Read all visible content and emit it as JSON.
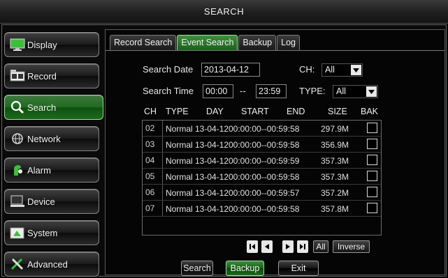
{
  "window": {
    "title": "SEARCH"
  },
  "sidebar": {
    "items": [
      {
        "label": "Display",
        "icon": "monitor-icon"
      },
      {
        "label": "Record",
        "icon": "film-icon"
      },
      {
        "label": "Search",
        "icon": "search-icon",
        "active": true
      },
      {
        "label": "Network",
        "icon": "globe-icon"
      },
      {
        "label": "Alarm",
        "icon": "alarm-icon"
      },
      {
        "label": "Device",
        "icon": "device-icon"
      },
      {
        "label": "System",
        "icon": "system-icon"
      },
      {
        "label": "Advanced",
        "icon": "tools-icon"
      }
    ]
  },
  "tabs": [
    {
      "label": "Record Search"
    },
    {
      "label": "Event Search",
      "active": true
    },
    {
      "label": "Backup"
    },
    {
      "label": "Log"
    }
  ],
  "form": {
    "search_date_label": "Search Date",
    "search_date_value": "2013-04-12",
    "ch_label": "CH:",
    "ch_value": "All",
    "search_time_label": "Search Time",
    "time_from": "00:00",
    "time_sep": "--",
    "time_to": "23:59",
    "type_label": "TYPE:",
    "type_value": "All"
  },
  "table": {
    "headers": [
      "CH",
      "TYPE",
      "DAY",
      "START",
      "END",
      "SIZE",
      "BAK"
    ],
    "rows": [
      {
        "ch": "02",
        "type": "Normal",
        "day": "13-04-12",
        "range": "00:00:00--00:59:58",
        "size": "297.9M"
      },
      {
        "ch": "03",
        "type": "Normal",
        "day": "13-04-12",
        "range": "00:00:00--00:59:58",
        "size": "356.9M"
      },
      {
        "ch": "04",
        "type": "Normal",
        "day": "13-04-12",
        "range": "00:00:00--00:59:59",
        "size": "357.3M"
      },
      {
        "ch": "05",
        "type": "Normal",
        "day": "13-04-12",
        "range": "00:00:00--00:59:58",
        "size": "357.3M"
      },
      {
        "ch": "06",
        "type": "Normal",
        "day": "13-04-12",
        "range": "00:00:00--00:59:57",
        "size": "357.2M"
      },
      {
        "ch": "07",
        "type": "Normal",
        "day": "13-04-12",
        "range": "00:00:00--00:59:58",
        "size": "357.8M"
      }
    ]
  },
  "pager": {
    "first_icon": "first-page-icon",
    "prev_icon": "prev-page-icon",
    "next_icon": "next-page-icon",
    "last_icon": "last-page-icon",
    "all_label": "All",
    "inverse_label": "Inverse"
  },
  "actions": {
    "search_label": "Search",
    "backup_label": "Backup",
    "exit_label": "Exit"
  },
  "colors": {
    "accent_green": "#1f6a1f",
    "highlight_green": "#9fe09f",
    "background": "#000000"
  }
}
